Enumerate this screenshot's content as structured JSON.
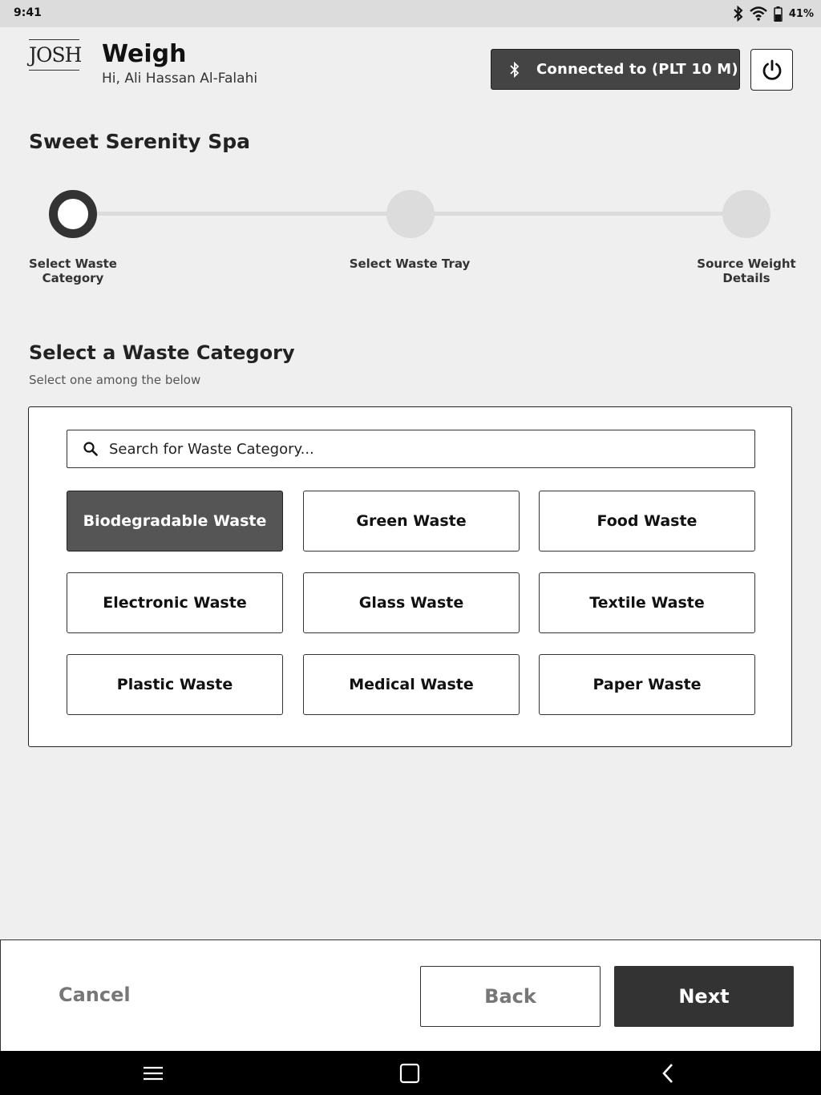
{
  "status_bar": {
    "time": "9:41",
    "battery_percent": "41%",
    "icons": [
      "bluetooth-icon",
      "wifi-icon",
      "battery-icon"
    ]
  },
  "header": {
    "logo_text": "JOSH",
    "title": "Weigh",
    "greeting": "Hi, Ali Hassan Al-Falahi",
    "connection_label": "Connected to (PLT 10 M)",
    "connection_icon": "bluetooth-icon",
    "power_icon": "power-icon"
  },
  "location": {
    "name": "Sweet Serenity Spa"
  },
  "stepper": {
    "steps": [
      {
        "label_line1": "Select Waste",
        "label_line2": "Category",
        "active": true
      },
      {
        "label_line1": "Select Waste Tray",
        "label_line2": "",
        "active": false
      },
      {
        "label_line1": "Source Weight",
        "label_line2": "Details",
        "active": false
      }
    ]
  },
  "category_section": {
    "title": "Select a Waste Category",
    "subtitle": "Select one among the below",
    "search_placeholder": "Search for Waste Category...",
    "selected": "Biodegradable Waste",
    "categories": [
      "Biodegradable Waste",
      "Green Waste",
      "Food Waste",
      "Electronic Waste",
      "Glass Waste",
      "Textile Waste",
      "Plastic Waste",
      "Medical Waste",
      "Paper Waste"
    ]
  },
  "footer": {
    "cancel_label": "Cancel",
    "back_label": "Back",
    "next_label": "Next"
  },
  "colors": {
    "background": "#efefef",
    "dark": "#333333",
    "selected": "#555555",
    "muted_text": "#777777"
  }
}
